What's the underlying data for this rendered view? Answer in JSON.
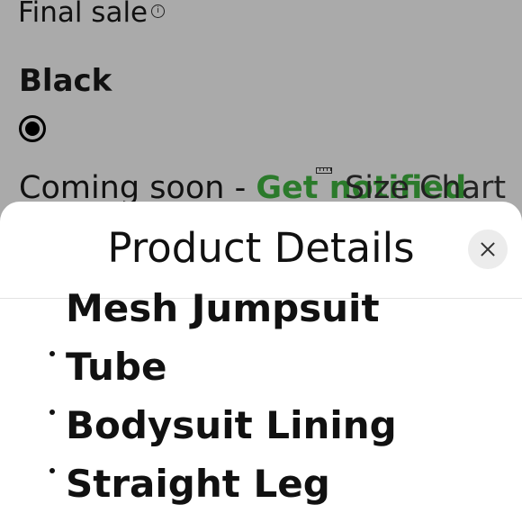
{
  "background": {
    "final_sale_label": "Final sale",
    "color_label": "Black",
    "coming_soon_label": "Coming soon - ",
    "get_notified_label": "Get notified",
    "size_chart_label": "Size Chart",
    "accent_color": "#2b7a2b"
  },
  "sheet": {
    "title": "Product Details",
    "close_icon": "close-icon",
    "details": [
      {
        "label": "Mesh Jumpsuit",
        "has_bullet": false
      },
      {
        "label": "Tube",
        "has_bullet": true
      },
      {
        "label": "Bodysuit Lining",
        "has_bullet": true
      },
      {
        "label": "Straight Leg",
        "has_bullet": true
      }
    ]
  }
}
